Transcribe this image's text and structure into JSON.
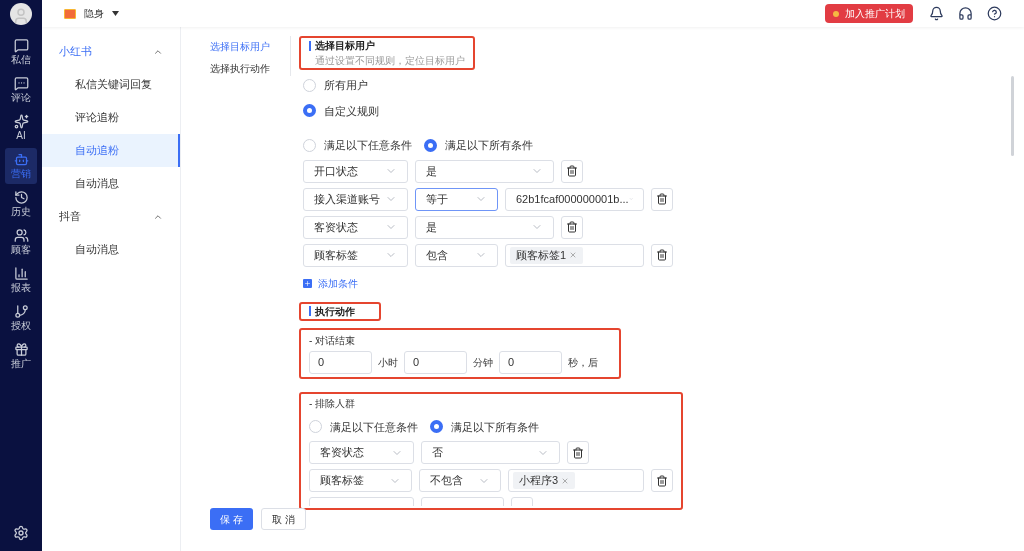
{
  "top_bar": {
    "status": "隐身",
    "promo_button": "加入推广计划"
  },
  "nav_rail": [
    {
      "kind": "chat",
      "label": "私信",
      "selected": false
    },
    {
      "kind": "comment",
      "label": "评论",
      "selected": false
    },
    {
      "kind": "ai",
      "label": "AI",
      "selected": false
    },
    {
      "kind": "robot",
      "label": "营销",
      "selected": true
    },
    {
      "kind": "history",
      "label": "历史",
      "selected": false
    },
    {
      "kind": "users",
      "label": "顾客",
      "selected": false
    },
    {
      "kind": "chart",
      "label": "报表",
      "selected": false
    },
    {
      "kind": "branch",
      "label": "授权",
      "selected": false
    },
    {
      "kind": "gift",
      "label": "推广",
      "selected": false
    }
  ],
  "menu": [
    {
      "label": "小红书",
      "expanded": true,
      "children": [
        {
          "label": "私信关键词回复",
          "selected": false
        },
        {
          "label": "评论追粉",
          "selected": false
        },
        {
          "label": "自动追粉",
          "selected": true
        },
        {
          "label": "自动消息",
          "selected": false
        }
      ]
    },
    {
      "label": "抖音",
      "expanded": true,
      "children": [
        {
          "label": "自动消息",
          "selected": false
        }
      ]
    }
  ],
  "steps": [
    {
      "label": "选择目标用户",
      "selected": true
    },
    {
      "label": "选择执行动作",
      "selected": false
    }
  ],
  "target_section": {
    "title": "选择目标用户",
    "subtitle": "通过设置不同规则，定位目标用户"
  },
  "user_scope": [
    {
      "label": "所有用户",
      "selected": false
    },
    {
      "label": "自定义规则",
      "selected": true
    }
  ],
  "match_mode": [
    {
      "label": "满足以下任意条件",
      "selected": false
    },
    {
      "label": "满足以下所有条件",
      "selected": true
    }
  ],
  "conditions": [
    {
      "kind": "select",
      "field": "开口状态",
      "operator": "是",
      "operator_focused": false
    },
    {
      "kind": "value",
      "field": "接入渠道账号",
      "operator": "等于",
      "operator_focused": true,
      "value": "62b1fcaf000000001b..."
    },
    {
      "kind": "select",
      "field": "客资状态",
      "operator": "是",
      "operator_focused": false
    },
    {
      "kind": "tags",
      "field": "顾客标签",
      "operator": "包含",
      "operator_focused": false,
      "tags": [
        "顾客标签1"
      ]
    }
  ],
  "add_condition": "添加条件",
  "action_section": {
    "title": "执行动作"
  },
  "conversation_end": {
    "title": "- 对话结束",
    "inputs": [
      {
        "value": "0",
        "unit": "小时"
      },
      {
        "value": "0",
        "unit": "分钟"
      },
      {
        "value": "0",
        "unit": "秒，后"
      }
    ]
  },
  "exclude": {
    "title": "- 排除人群",
    "match_mode": [
      {
        "label": "满足以下任意条件",
        "selected": false
      },
      {
        "label": "满足以下所有条件",
        "selected": true
      }
    ],
    "conditions": [
      {
        "kind": "select",
        "field": "客资状态",
        "operator": "否",
        "operator_focused": false
      },
      {
        "kind": "tags",
        "field": "顾客标签",
        "operator": "不包含",
        "operator_focused": false,
        "tags": [
          "小程序3"
        ]
      },
      {
        "kind": "clipped"
      }
    ]
  },
  "buttons": [
    {
      "kind": "primary",
      "label": "保 存"
    },
    {
      "kind": "default",
      "label": "取 消"
    }
  ]
}
